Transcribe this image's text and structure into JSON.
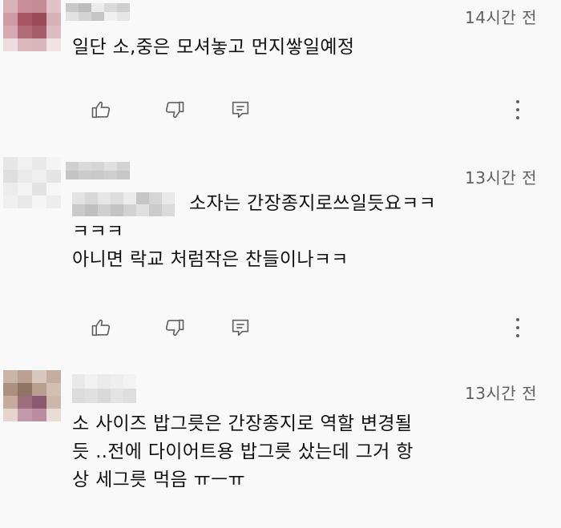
{
  "comments": [
    {
      "timestamp": "14시간 전",
      "lines": [
        "일단 소,중은 모셔놓고 먼지쌓일예정"
      ],
      "avatar_palette": [
        "#d9b3ba",
        "#c98f9a",
        "#c48a95",
        "#e0c2c8",
        "#cf9aa4",
        "#a85566",
        "#9b4a5a",
        "#d7b2b9",
        "#d6aab3",
        "#b06a78",
        "#a55c6b",
        "#dcbcc2",
        "#eddde0",
        "#d9b7bd",
        "#d8b5bc",
        "#efe3e5"
      ],
      "author_palette": [
        "#c8c8c8",
        "#e2e2e2",
        "#bcbcbc",
        "#d4d4d4",
        "#ebebeb",
        "#c6c6c6",
        "#d9d9d9",
        "#f0f0f0",
        "#cfcfcf",
        "#e6e6e6"
      ]
    },
    {
      "timestamp": "13시간 전",
      "mention_text": "소자는 간장종지로쓰일듯요ㅋㅋ",
      "lines": [
        "ㅋㅋㅋ",
        "아니면 락교 처럼작은 찬들이나ㅋㅋ"
      ],
      "avatar_palette": [
        "#e6e6e6",
        "#f1f1f1",
        "#e9e9e9",
        "#f4f4f4",
        "#dedede",
        "#eaeaea",
        "#f0f0f0",
        "#e4e4e4",
        "#ececec",
        "#f3f3f3",
        "#e2e2e2",
        "#f6f6f6",
        "#f0f0f0",
        "#e8e8e8",
        "#f5f5f5",
        "#ededed"
      ],
      "author_palette": [
        "#d0d0d0",
        "#c4c4c4",
        "#dadada",
        "#cbcbcb",
        "#d6d6d6",
        "#c9c9c9",
        "#e0e0e0",
        "#cecece",
        "#d3d3d3",
        "#c7c7c7"
      ],
      "mention_palette": [
        "#e3e3e3",
        "#c9c9c9",
        "#d8d8d8",
        "#bfbfbf",
        "#e6e6e6",
        "#cfcfcf",
        "#dddddd",
        "#c3c3c3",
        "#ebebeb",
        "#d2d2d2",
        "#c6c6c6",
        "#e0e0e0",
        "#d5d5d5",
        "#cbcbcb",
        "#e8e8e8",
        "#dadada"
      ]
    },
    {
      "timestamp": "13시간 전",
      "lines": [
        "소 사이즈 밥그릇은 간장종지로 역할 변경될",
        "듯 ..전에 다이어트용 밥그릇 샀는데 그거 항",
        "상 세그릇 먹음 ㅠㅡㅠ"
      ],
      "avatar_palette": [
        "#c9b4a6",
        "#b9a090",
        "#d8c9be",
        "#c4ad9e",
        "#a9907f",
        "#8f7464",
        "#b89e8d",
        "#d2bfb2",
        "#c7aa9b",
        "#9c6f7f",
        "#8a5a70",
        "#cdb7a9",
        "#e4d6cd",
        "#c39aa8",
        "#b98d9d",
        "#e8ddd6"
      ],
      "author_palette": [
        "#e8e8e8",
        "#dcdcdc",
        "#f1f1f1",
        "#e0e0e0",
        "#ebebeb",
        "#d9d9d9",
        "#eeeeee",
        "#e3e3e3",
        "#f3f3f3",
        "#dedede"
      ]
    }
  ],
  "action_icons": {
    "like": "thumbs-up-icon",
    "dislike": "thumbs-down-icon",
    "reply": "reply-icon",
    "more": "more-vert-icon"
  },
  "colors": {
    "background": "#f9f9f9",
    "text": "#111111",
    "secondary_text": "#606060",
    "icon": "#606060"
  }
}
